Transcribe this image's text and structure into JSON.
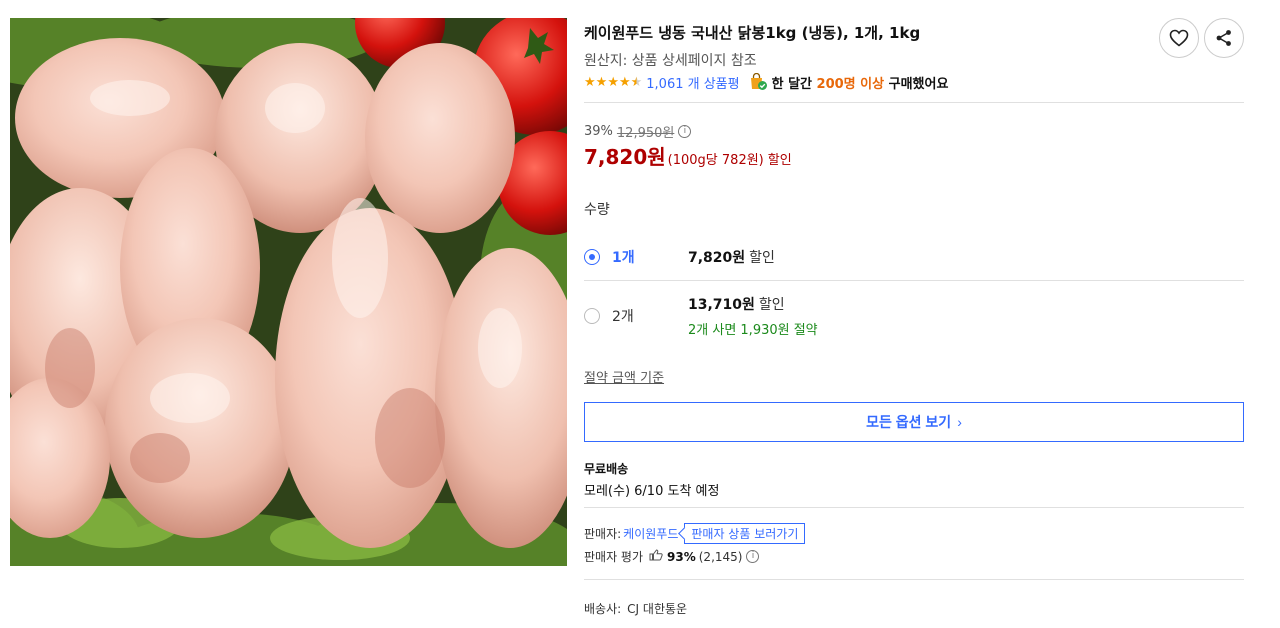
{
  "product": {
    "title": "케이원푸드 냉동 국내산 닭봉1kg (냉동), 1개, 1kg",
    "origin": "원산지: 상품 상세페이지 참조",
    "image_alt": "냉동 닭봉"
  },
  "rating": {
    "stars": 4.5,
    "review_count_text": "1,061 개 상품평",
    "purchase_prefix": "한 달간 ",
    "purchase_highlight": "200명 이상",
    "purchase_suffix": " 구매했어요"
  },
  "actions": {
    "wishlist_icon": "heart-icon",
    "share_icon": "share-icon"
  },
  "price": {
    "discount_rate": "39%",
    "original_price": "12,950원",
    "final_price": "7,820원",
    "unit_price": "(100g당 782원)",
    "sale_label": "할인"
  },
  "quantity": {
    "label": "수량",
    "options": [
      {
        "qty": "1개",
        "price": "7,820원",
        "sale": "할인",
        "selected": true,
        "savings": ""
      },
      {
        "qty": "2개",
        "price": "13,710원",
        "sale": "할인",
        "selected": false,
        "savings": "2개 사면 1,930원 절약"
      }
    ],
    "savings_basis_link": "절약 금액 기준",
    "all_options_button": "모든 옵션 보기"
  },
  "shipping": {
    "label": "무료배송",
    "arrival": "모레(수) 6/10 도착 예정"
  },
  "seller": {
    "label": "판매자:",
    "name": "케이원푸드",
    "view_products": "판매자 상품 보러가기",
    "rating_label": "판매자 평가",
    "rating_pct": "93%",
    "rating_count": "(2,145)"
  },
  "carrier": {
    "label": "배송사:",
    "name": "CJ 대한통운"
  },
  "colors": {
    "accent_blue": "#346aff",
    "price_red": "#ae0000",
    "savings_green": "#1c8a1c",
    "highlight_orange": "#e8680a"
  }
}
